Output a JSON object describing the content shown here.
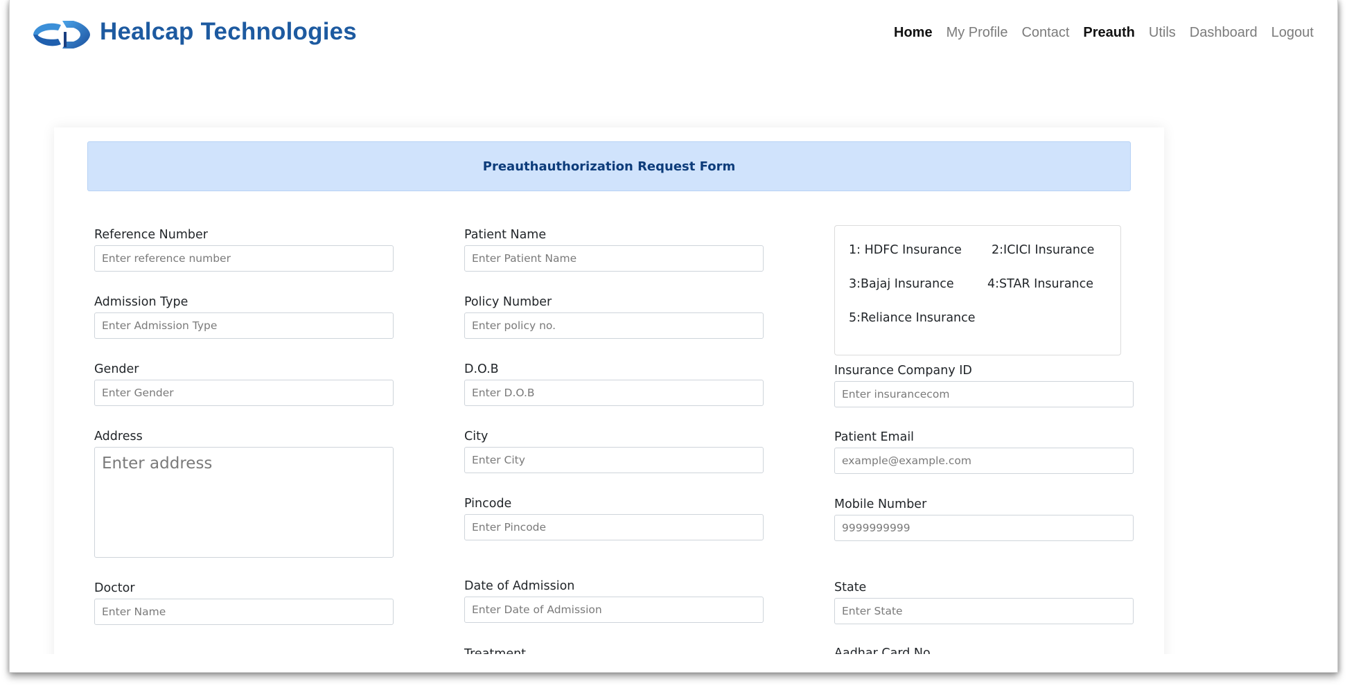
{
  "header": {
    "brand": "Healcap Technologies",
    "nav": [
      {
        "label": "Home",
        "active": true
      },
      {
        "label": "My Profile",
        "active": false
      },
      {
        "label": "Contact",
        "active": false
      },
      {
        "label": "Preauth",
        "active": true
      },
      {
        "label": "Utils",
        "active": false
      },
      {
        "label": "Dashboard",
        "active": false
      },
      {
        "label": "Logout",
        "active": false
      }
    ]
  },
  "form": {
    "title": "Preauthauthorization Request Form",
    "fields": {
      "reference_number": {
        "label": "Reference Number",
        "placeholder": "Enter reference number"
      },
      "patient_name": {
        "label": "Patient Name",
        "placeholder": "Enter Patient Name"
      },
      "admission_type": {
        "label": "Admission Type",
        "placeholder": "Enter Admission Type"
      },
      "policy_number": {
        "label": "Policy Number",
        "placeholder": "Enter policy no."
      },
      "gender": {
        "label": "Gender",
        "placeholder": "Enter Gender"
      },
      "dob": {
        "label": "D.O.B",
        "placeholder": "Enter D.O.B"
      },
      "insurance_company_id": {
        "label": "Insurance Company ID",
        "placeholder": "Enter insurancecom"
      },
      "address": {
        "label": "Address",
        "placeholder": "Enter address"
      },
      "city": {
        "label": "City",
        "placeholder": "Enter City"
      },
      "patient_email": {
        "label": "Patient Email",
        "placeholder": "example@example.com"
      },
      "pincode": {
        "label": "Pincode",
        "placeholder": "Enter Pincode"
      },
      "mobile_number": {
        "label": "Mobile Number",
        "placeholder": "9999999999"
      },
      "doctor": {
        "label": "Doctor",
        "placeholder": "Enter Name"
      },
      "date_of_admission": {
        "label": "Date of Admission",
        "placeholder": "Enter Date of Admission"
      },
      "state": {
        "label": "State",
        "placeholder": "Enter State"
      },
      "treatment": {
        "label": "Treatment"
      },
      "aadhar_card_no": {
        "label": "Aadhar Card No"
      }
    },
    "insurance_list": [
      "1: HDFC Insurance",
      "2:ICICI Insurance",
      "3:Bajaj Insurance",
      "4:STAR Insurance",
      "5:Reliance Insurance"
    ]
  }
}
